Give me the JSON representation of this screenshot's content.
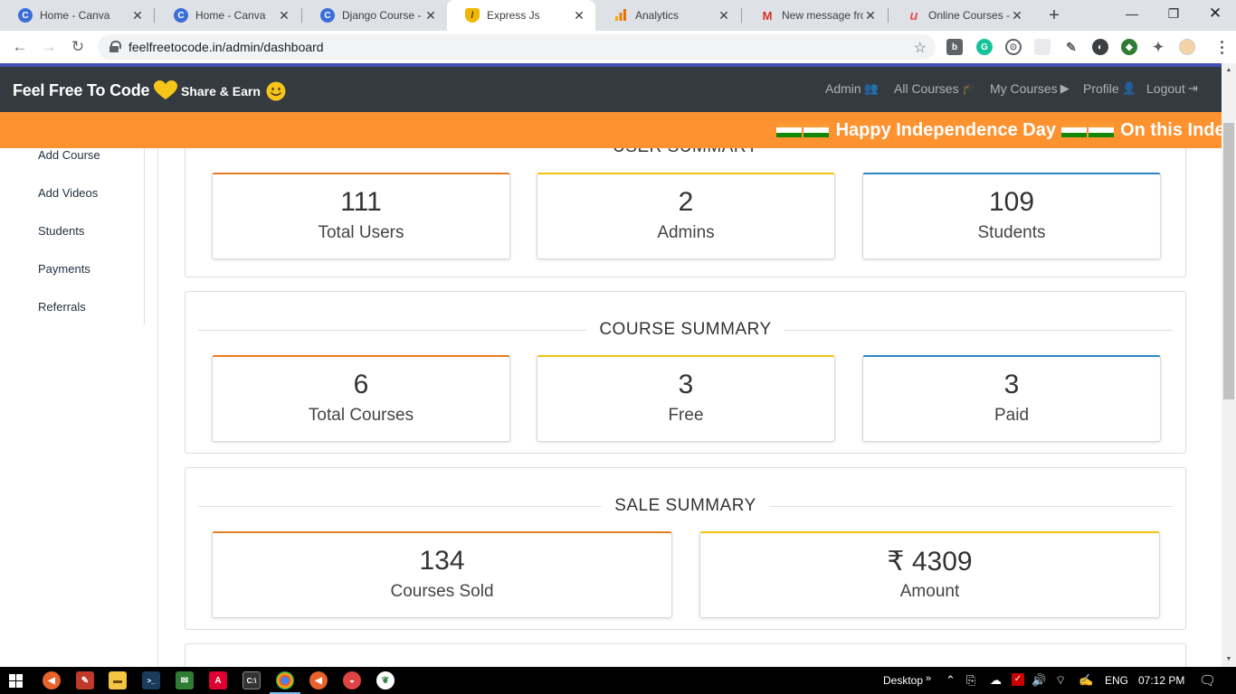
{
  "browser": {
    "tabs": [
      {
        "label": "Home - Canva",
        "icon": "canva-icon",
        "color": "#3b6fd8",
        "glyph": "C"
      },
      {
        "label": "Home - Canva",
        "icon": "canva-icon",
        "color": "#3b6fd8",
        "glyph": "C"
      },
      {
        "label": "Django Course - Yo",
        "icon": "canva-icon",
        "color": "#3b6fd8",
        "glyph": "C"
      },
      {
        "label": "Express Js",
        "icon": "shield-icon",
        "color": "#f2b705",
        "glyph": "/"
      },
      {
        "label": "Analytics",
        "icon": "analytics-icon",
        "color": "#f57c00",
        "glyph": "▮"
      },
      {
        "label": "New message from",
        "icon": "gmail-icon",
        "color": "#ffffff",
        "glyph": "M"
      },
      {
        "label": "Online Courses - A",
        "icon": "udemy-icon",
        "color": "#ffffff",
        "glyph": "u"
      }
    ],
    "url": "feelfreetocode.in/admin/dashboard"
  },
  "site": {
    "brand": "Feel Free To Code",
    "share": "Share & Earn",
    "nav": [
      {
        "label": "Admin",
        "icon": "user-cog-icon",
        "glyph": "👥"
      },
      {
        "label": "All Courses",
        "icon": "graduation-cap-icon",
        "glyph": "🎓"
      },
      {
        "label": "My Courses",
        "icon": "play-icon",
        "glyph": "▶"
      },
      {
        "label": "Profile",
        "icon": "user-icon",
        "glyph": "👤"
      },
      {
        "label": "Logout",
        "icon": "sign-out-icon",
        "glyph": "⇥"
      }
    ],
    "announcement_a": "Happy Independence Day",
    "announcement_b": "On this Indep"
  },
  "sidebar": {
    "items": [
      "Add Course",
      "Add Videos",
      "Students",
      "Payments",
      "Referrals"
    ]
  },
  "user_summary": {
    "title": "USER SUMMARY",
    "stats": [
      {
        "value": "111",
        "label": "Total Users"
      },
      {
        "value": "2",
        "label": "Admins"
      },
      {
        "value": "109",
        "label": "Students"
      }
    ]
  },
  "course_summary": {
    "title": "COURSE SUMMARY",
    "stats": [
      {
        "value": "6",
        "label": "Total Courses"
      },
      {
        "value": "3",
        "label": "Free"
      },
      {
        "value": "3",
        "label": "Paid"
      }
    ]
  },
  "sale_summary": {
    "title": "SALE SUMMARY",
    "stats": [
      {
        "value": "134",
        "label": "Courses Sold"
      },
      {
        "value": "₹ 4309",
        "label": "Amount"
      }
    ]
  },
  "colors": {
    "orange": "#e67e22",
    "yellow": "#f1c40f",
    "blue": "#2e86c1",
    "announce": "#fd9230",
    "navbar": "#343a40"
  },
  "taskbar": {
    "desktop": "Desktop",
    "lang": "ENG",
    "time": "07:12 PM"
  }
}
